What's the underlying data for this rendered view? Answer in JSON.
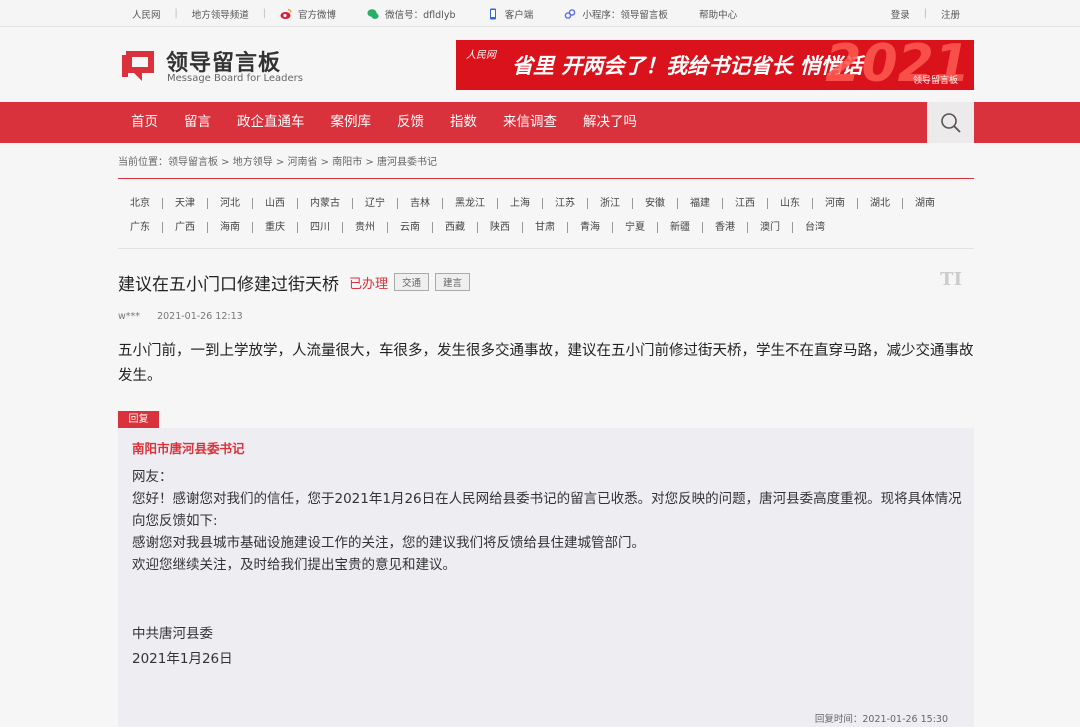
{
  "topbar": {
    "left": [
      "人民网",
      "地方领导频道",
      "官方微博",
      "微信号：dfldlyb",
      "客户端",
      "小程序：领导留言板",
      "帮助中心"
    ],
    "right": [
      "登录",
      "注册"
    ]
  },
  "logo": {
    "name": "领导留言板",
    "sub": "Message Board for Leaders"
  },
  "banner": {
    "source": "人民网",
    "text": "省里 开两会了！我给书记省长 悄悄话",
    "year": "2021",
    "brand": "领导留言板"
  },
  "nav": {
    "items": [
      "首页",
      "留言",
      "政企直通车",
      "案例库",
      "反馈",
      "指数",
      "来信调查",
      "解决了吗"
    ]
  },
  "breadcrumb": "当前位置：领导留言板 > 地方领导 > 河南省 > 南阳市 > 唐河县委书记",
  "regions": {
    "row1": [
      "北京",
      "天津",
      "河北",
      "山西",
      "内蒙古",
      "辽宁",
      "吉林",
      "黑龙江",
      "上海",
      "江苏",
      "浙江",
      "安徽",
      "福建",
      "江西",
      "山东",
      "河南",
      "湖北",
      "湖南"
    ],
    "row2": [
      "广东",
      "广西",
      "海南",
      "重庆",
      "四川",
      "贵州",
      "云南",
      "西藏",
      "陕西",
      "甘肃",
      "青海",
      "宁夏",
      "新疆",
      "香港",
      "澳门",
      "台湾"
    ]
  },
  "message": {
    "title": "建议在五小门口修建过街天桥",
    "status": "已办理",
    "tags": [
      "交通",
      "建言"
    ],
    "author": "w***",
    "time": "2021-01-26 12:13",
    "body": "五小门前，一到上学放学，人流量很大，车很多，发生很多交通事故，建议在五小门前修过街天桥，学生不在直穿马路，减少交通事故发生。"
  },
  "reply": {
    "tag": "回复",
    "from": "南阳市唐河县委书记",
    "lines": [
      "网友：",
      "您好！感谢您对我们的信任，您于2021年1月26日在人民网给县委书记的留言已收悉。对您反映的问题，唐河县委高度重视。现将具体情况向您反馈如下:",
      "感谢您对我县城市基础设施建设工作的关注，您的建议我们将反馈给县住建城管部门。",
      "欢迎您继续关注，及时给我们提出宝贵的意见和建议。"
    ],
    "sign_org": "中共唐河县委",
    "sign_date": "2021年1月26日",
    "time": "回复时间：2021-01-26 15:30"
  },
  "colors": {
    "accent": "#d9323c",
    "banner": "#d9121c"
  }
}
